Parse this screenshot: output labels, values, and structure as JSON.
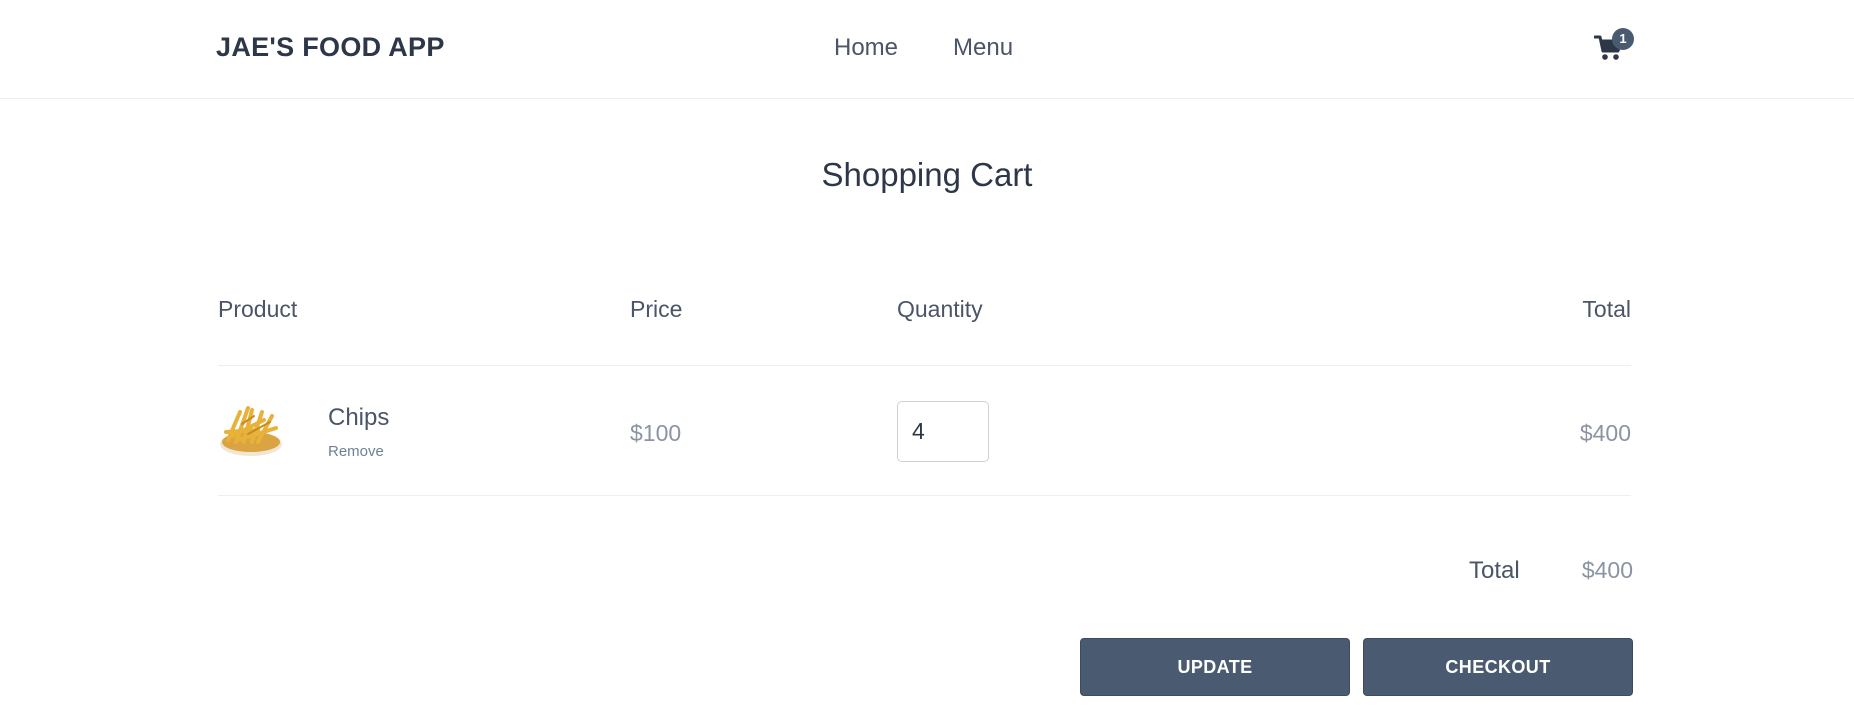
{
  "header": {
    "brand": "JAE'S FOOD APP",
    "nav": {
      "home": "Home",
      "menu": "Menu"
    },
    "cart_count": "1",
    "cart_icon": "shopping-cart-icon"
  },
  "page": {
    "title": "Shopping Cart"
  },
  "table": {
    "headers": {
      "product": "Product",
      "price": "Price",
      "quantity": "Quantity",
      "total": "Total"
    },
    "rows": [
      {
        "image_icon": "french-fries-image",
        "name": "Chips",
        "remove_label": "Remove",
        "price": "$100",
        "quantity": "4",
        "total": "$400"
      }
    ]
  },
  "summary": {
    "label": "Total",
    "value": "$400"
  },
  "actions": {
    "update": "UPDATE",
    "checkout": "CHECKOUT"
  },
  "colors": {
    "text_dark": "#2d3748",
    "text": "#4a5568",
    "muted": "#8a94a3",
    "button_bg": "#4a5a70",
    "badge_bg": "#4a5a70"
  }
}
